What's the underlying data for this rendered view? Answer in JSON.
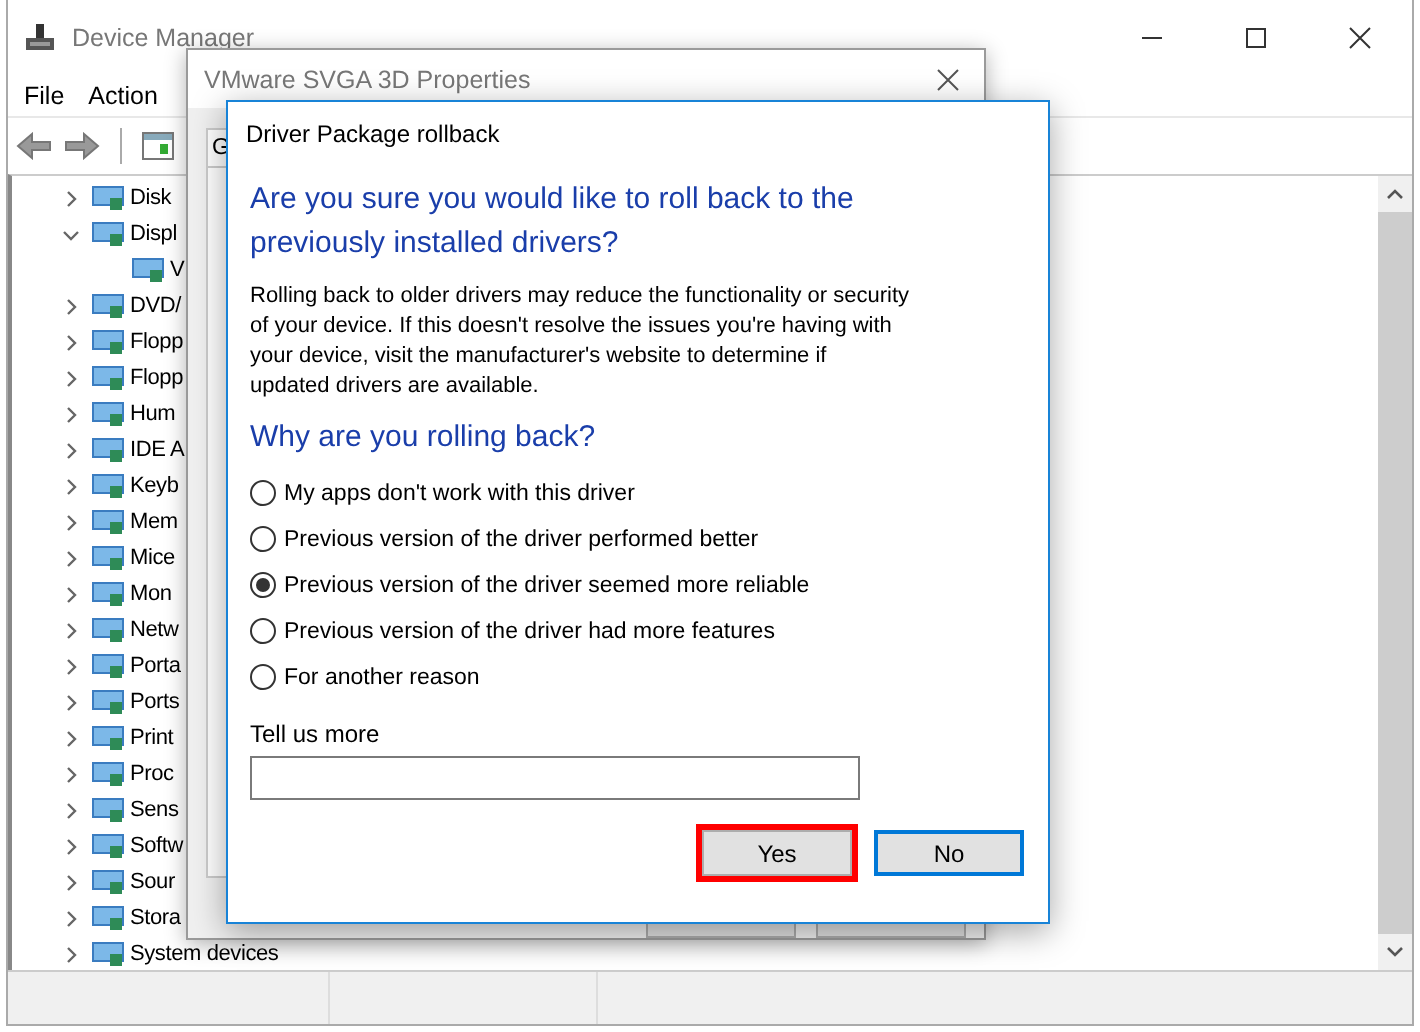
{
  "device_manager": {
    "title": "Device Manager",
    "menu": [
      "File",
      "Action"
    ],
    "tree": [
      {
        "label": "Disk",
        "expanded": false
      },
      {
        "label": "Displ",
        "expanded": true,
        "children": [
          {
            "label": "V"
          }
        ]
      },
      {
        "label": "DVD/",
        "expanded": false
      },
      {
        "label": "Flopp",
        "expanded": false
      },
      {
        "label": "Flopp",
        "expanded": false
      },
      {
        "label": "Hum",
        "expanded": false
      },
      {
        "label": "IDE A",
        "expanded": false
      },
      {
        "label": "Keyb",
        "expanded": false
      },
      {
        "label": "Mem",
        "expanded": false
      },
      {
        "label": "Mice",
        "expanded": false
      },
      {
        "label": "Mon",
        "expanded": false
      },
      {
        "label": "Netw",
        "expanded": false
      },
      {
        "label": "Porta",
        "expanded": false
      },
      {
        "label": "Ports",
        "expanded": false
      },
      {
        "label": "Print",
        "expanded": false
      },
      {
        "label": "Proc",
        "expanded": false
      },
      {
        "label": "Sens",
        "expanded": false
      },
      {
        "label": "Softw",
        "expanded": false
      },
      {
        "label": "Sour",
        "expanded": false
      },
      {
        "label": "Stora",
        "expanded": false
      },
      {
        "label": "System devices",
        "expanded": false
      }
    ]
  },
  "properties_window": {
    "title": "VMware SVGA 3D Properties",
    "tabs": [
      "G"
    ]
  },
  "dialog": {
    "title": "Driver Package rollback",
    "heading": "Are you sure you would like to roll back to the previously installed drivers?",
    "body": "Rolling back to older drivers may reduce the functionality or security of your device.  If this doesn't resolve the issues you're having with your device, visit the manufacturer's website to determine if updated drivers are available.",
    "question": "Why are you rolling back?",
    "reasons": [
      {
        "label": "My apps don't work with this driver",
        "selected": false
      },
      {
        "label": "Previous version of the driver performed better",
        "selected": false
      },
      {
        "label": "Previous version of the driver seemed more reliable",
        "selected": true
      },
      {
        "label": "Previous version of the driver had more features",
        "selected": false
      },
      {
        "label": "For another reason",
        "selected": false
      }
    ],
    "details_label": "Tell us more",
    "buttons": [
      {
        "label": "Yes",
        "highlighted": true,
        "focused": false
      },
      {
        "label": "No",
        "highlighted": false,
        "focused": true
      }
    ]
  }
}
